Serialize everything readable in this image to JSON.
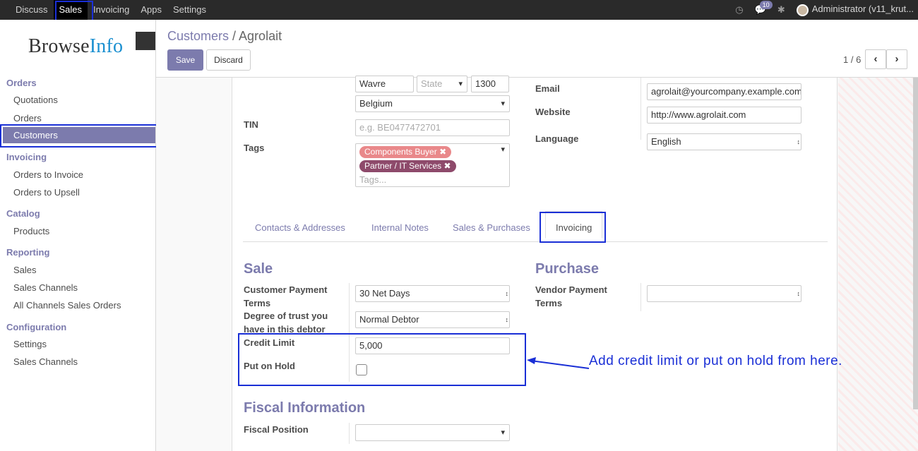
{
  "topbar": {
    "menu": [
      "Discuss",
      "Sales",
      "Invoicing",
      "Apps",
      "Settings"
    ],
    "active": "Sales",
    "messages_count": "10",
    "user": "Administrator (v11_krut..."
  },
  "logo": {
    "part1": "Browse",
    "part2": "Info"
  },
  "sidebar": {
    "orders_head": "Orders",
    "quotations": "Quotations",
    "orders": "Orders",
    "customers": "Customers",
    "invoicing_head": "Invoicing",
    "orders_to_invoice": "Orders to Invoice",
    "orders_to_upsell": "Orders to Upsell",
    "catalog_head": "Catalog",
    "products": "Products",
    "reporting_head": "Reporting",
    "sales": "Sales",
    "sales_channels": "Sales Channels",
    "all_channels": "All Channels Sales Orders",
    "config_head": "Configuration",
    "settings": "Settings",
    "config_sales_channels": "Sales Channels"
  },
  "control": {
    "breadcrumb_parent": "Customers",
    "breadcrumb_sep": " / ",
    "breadcrumb_current": "Agrolait",
    "save": "Save",
    "discard": "Discard",
    "pager": "1 / 6"
  },
  "form": {
    "city": "Wavre",
    "state_placeholder": "State",
    "zip": "1300",
    "country": "Belgium",
    "tin_label": "TIN",
    "tin_placeholder": "e.g. BE0477472701",
    "tags_label": "Tags",
    "tags": [
      {
        "name": "Components Buyer",
        "color": "#e9888a"
      },
      {
        "name": "Partner / IT Services",
        "color": "#8e4a6b"
      }
    ],
    "tags_placeholder": "Tags...",
    "email_label": "Email",
    "email": "agrolait@yourcompany.example.com",
    "website_label": "Website",
    "website": "http://www.agrolait.com",
    "language_label": "Language",
    "language": "English"
  },
  "tabs": [
    "Contacts & Addresses",
    "Internal Notes",
    "Sales & Purchases",
    "Invoicing"
  ],
  "active_tab": "Invoicing",
  "sale": {
    "title": "Sale",
    "payment_terms_label": "Customer Payment Terms",
    "payment_terms": "30 Net Days",
    "trust_label": "Degree of trust you have in this debtor",
    "trust": "Normal Debtor",
    "credit_limit_label": "Credit Limit",
    "credit_limit": "5,000",
    "on_hold_label": "Put on Hold",
    "on_hold": false
  },
  "purchase": {
    "title": "Purchase",
    "vendor_terms_label": "Vendor Payment Terms",
    "vendor_terms": ""
  },
  "fiscal": {
    "title": "Fiscal Information",
    "position_label": "Fiscal Position",
    "position": ""
  },
  "annotation": "Add credit limit or put on hold from here.",
  "colors": {
    "accent": "#7c7bad",
    "highlight": "#1a2fd6"
  }
}
